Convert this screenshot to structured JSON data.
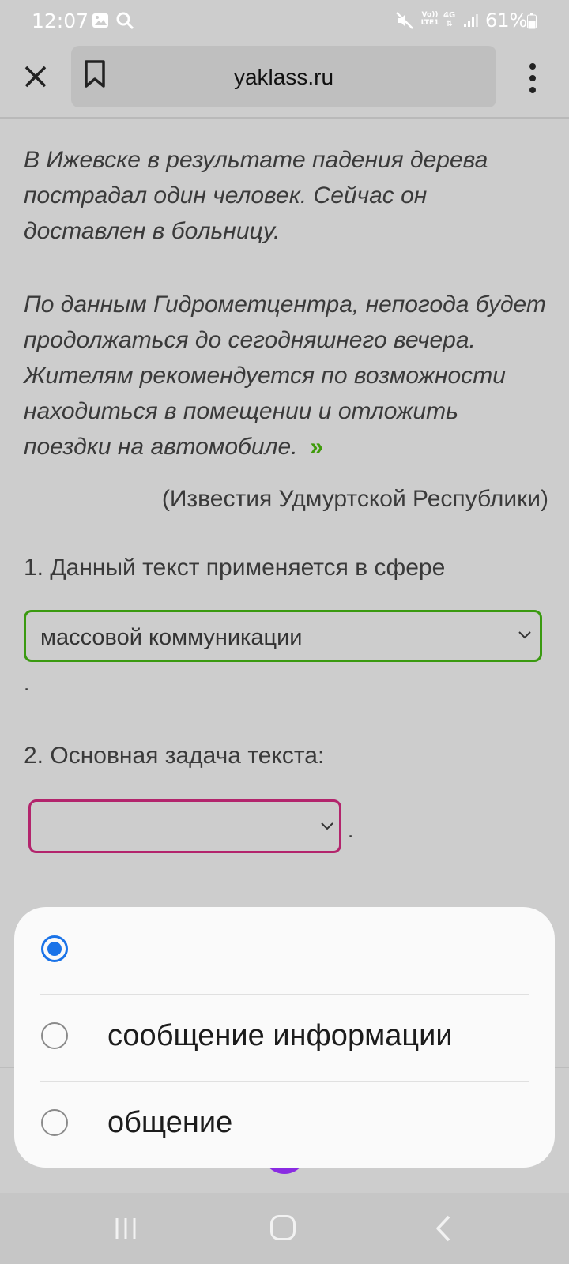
{
  "status_bar": {
    "time": "12:07",
    "volte_label": "Vo)) LTE1",
    "network_label": "4G",
    "battery_percent": "61%"
  },
  "browser": {
    "url": "yaklass.ru"
  },
  "article": {
    "paragraph1": "В Ижевске в результате падения дерева пострадал один человек. Сейчас он доставлен в больницу.",
    "paragraph2": "По данным Гидрометцентра, непогода будет продолжаться до сегодняшнего вечера. Жителям рекомендуется по возможности находиться в помещении и отложить поездки на автомобиле.",
    "quote_close": "»",
    "source": "(Известия Удмуртской Республики)"
  },
  "questions": {
    "q1_label": "1. Данный текст применяется в сфере",
    "q1_selected": "массовой коммуникации",
    "q1_trailing": ".",
    "q2_label": "2. Основная задача текста:",
    "q2_selected": "",
    "q2_trailing": "."
  },
  "dropdown_popup": {
    "options": [
      {
        "label": "",
        "checked": true
      },
      {
        "label": "сообщение информации",
        "checked": false
      },
      {
        "label": "общение",
        "checked": false
      }
    ]
  },
  "colors": {
    "accent_green": "#3a9a10",
    "accent_magenta": "#b3246c",
    "radio_blue": "#1a73e8"
  }
}
